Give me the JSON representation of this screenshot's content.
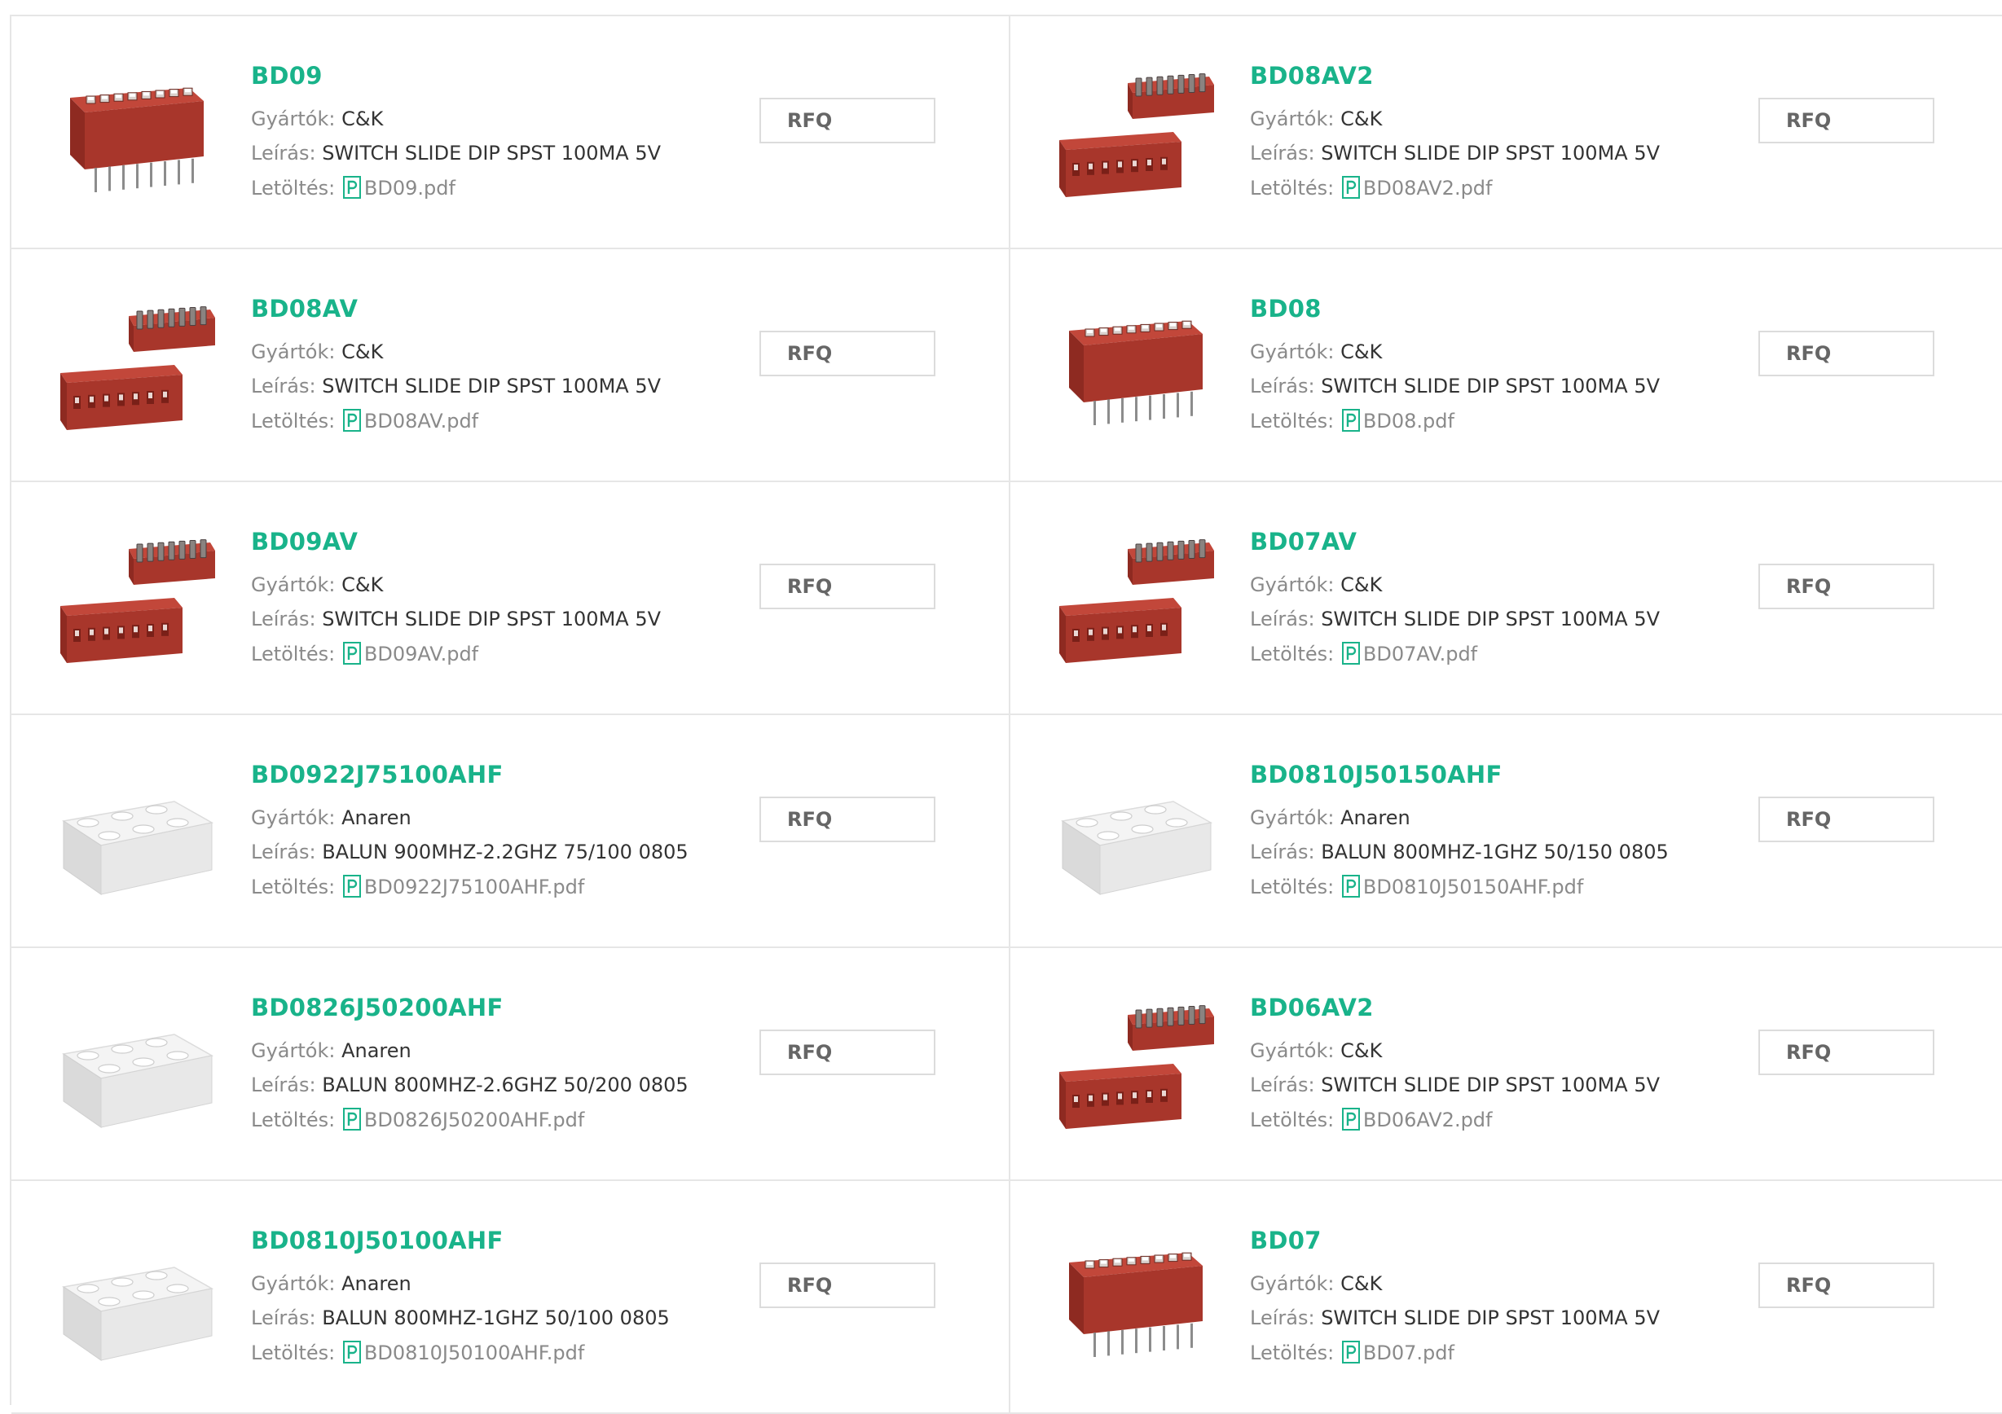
{
  "labels": {
    "manufacturer": "Gyártók:",
    "description": "Leírás:",
    "download": "Letöltés:"
  },
  "accent_color": "#19b38a",
  "products": [
    {
      "part": "BD09",
      "manufacturer": "C&K",
      "description": "SWITCH SLIDE DIP SPST 100MA 5V",
      "file": "BD09.pdf",
      "rfq": "RFQ",
      "image": "dip-switch-icon"
    },
    {
      "part": "BD08AV2",
      "manufacturer": "C&K",
      "description": "SWITCH SLIDE DIP SPST 100MA 5V",
      "file": "BD08AV2.pdf",
      "rfq": "RFQ",
      "image": "dip-switch-pair-icon"
    },
    {
      "part": "BD08AV",
      "manufacturer": "C&K",
      "description": "SWITCH SLIDE DIP SPST 100MA 5V",
      "file": "BD08AV.pdf",
      "rfq": "RFQ",
      "image": "dip-switch-pair-icon"
    },
    {
      "part": "BD08",
      "manufacturer": "C&K",
      "description": "SWITCH SLIDE DIP SPST 100MA 5V",
      "file": "BD08.pdf",
      "rfq": "RFQ",
      "image": "dip-switch-icon"
    },
    {
      "part": "BD09AV",
      "manufacturer": "C&K",
      "description": "SWITCH SLIDE DIP SPST 100MA 5V",
      "file": "BD09AV.pdf",
      "rfq": "RFQ",
      "image": "dip-switch-pair-icon"
    },
    {
      "part": "BD07AV",
      "manufacturer": "C&K",
      "description": "SWITCH SLIDE DIP SPST 100MA 5V",
      "file": "BD07AV.pdf",
      "rfq": "RFQ",
      "image": "dip-switch-pair-icon"
    },
    {
      "part": "BD0922J75100AHF",
      "manufacturer": "Anaren",
      "description": "BALUN 900MHZ-2.2GHZ 75/100 0805",
      "file": "BD0922J75100AHF.pdf",
      "rfq": "RFQ",
      "image": "balun-chip-icon"
    },
    {
      "part": "BD0810J50150AHF",
      "manufacturer": "Anaren",
      "description": "BALUN 800MHZ-1GHZ 50/150 0805",
      "file": "BD0810J50150AHF.pdf",
      "rfq": "RFQ",
      "image": "balun-chip-icon"
    },
    {
      "part": "BD0826J50200AHF",
      "manufacturer": "Anaren",
      "description": "BALUN 800MHZ-2.6GHZ 50/200 0805",
      "file": "BD0826J50200AHF.pdf",
      "rfq": "RFQ",
      "image": "balun-chip-icon"
    },
    {
      "part": "BD06AV2",
      "manufacturer": "C&K",
      "description": "SWITCH SLIDE DIP SPST 100MA 5V",
      "file": "BD06AV2.pdf",
      "rfq": "RFQ",
      "image": "dip-switch-pair-icon"
    },
    {
      "part": "BD0810J50100AHF",
      "manufacturer": "Anaren",
      "description": "BALUN 800MHZ-1GHZ 50/100 0805",
      "file": "BD0810J50100AHF.pdf",
      "rfq": "RFQ",
      "image": "balun-chip-icon"
    },
    {
      "part": "BD07",
      "manufacturer": "C&K",
      "description": "SWITCH SLIDE DIP SPST 100MA 5V",
      "file": "BD07.pdf",
      "rfq": "RFQ",
      "image": "dip-switch-icon"
    }
  ]
}
